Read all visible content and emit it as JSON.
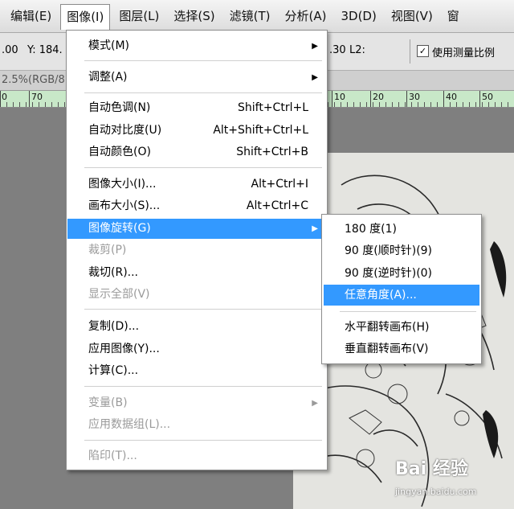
{
  "menubar": {
    "items": [
      "编辑(E)",
      "图像(I)",
      "图层(L)",
      "选择(S)",
      "滤镜(T)",
      "分析(A)",
      "3D(D)",
      "视图(V)",
      "窗"
    ]
  },
  "options_bar": {
    "x_value": ".00",
    "y_label": "Y: 184.",
    "right_value": ".30",
    "l2_label": "L2:",
    "checkbox_checked": true,
    "checkbox_label": "使用测量比例"
  },
  "document_tab": {
    "title": "2.5%(RGB/8"
  },
  "ruler": {
    "labels": [
      "0",
      "70",
      "10",
      "20",
      "30",
      "40",
      "50"
    ]
  },
  "image_menu": {
    "items": [
      {
        "label": "模式(M)",
        "shortcut": "",
        "submenu": true,
        "disabled": false
      },
      {
        "label": "调整(A)",
        "shortcut": "",
        "submenu": true,
        "disabled": false
      },
      {
        "label": "自动色调(N)",
        "shortcut": "Shift+Ctrl+L",
        "submenu": false,
        "disabled": false
      },
      {
        "label": "自动对比度(U)",
        "shortcut": "Alt+Shift+Ctrl+L",
        "submenu": false,
        "disabled": false
      },
      {
        "label": "自动颜色(O)",
        "shortcut": "Shift+Ctrl+B",
        "submenu": false,
        "disabled": false
      },
      {
        "label": "图像大小(I)...",
        "shortcut": "Alt+Ctrl+I",
        "submenu": false,
        "disabled": false
      },
      {
        "label": "画布大小(S)...",
        "shortcut": "Alt+Ctrl+C",
        "submenu": false,
        "disabled": false
      },
      {
        "label": "图像旋转(G)",
        "shortcut": "",
        "submenu": true,
        "disabled": false,
        "highlighted": true
      },
      {
        "label": "裁剪(P)",
        "shortcut": "",
        "submenu": false,
        "disabled": true
      },
      {
        "label": "裁切(R)...",
        "shortcut": "",
        "submenu": false,
        "disabled": false
      },
      {
        "label": "显示全部(V)",
        "shortcut": "",
        "submenu": false,
        "disabled": true
      },
      {
        "label": "复制(D)...",
        "shortcut": "",
        "submenu": false,
        "disabled": false
      },
      {
        "label": "应用图像(Y)...",
        "shortcut": "",
        "submenu": false,
        "disabled": false
      },
      {
        "label": "计算(C)...",
        "shortcut": "",
        "submenu": false,
        "disabled": false
      },
      {
        "label": "变量(B)",
        "shortcut": "",
        "submenu": true,
        "disabled": true
      },
      {
        "label": "应用数据组(L)...",
        "shortcut": "",
        "submenu": false,
        "disabled": true
      },
      {
        "label": "陷印(T)...",
        "shortcut": "",
        "submenu": false,
        "disabled": true
      }
    ]
  },
  "rotate_submenu": {
    "items": [
      {
        "label": "180 度(1)"
      },
      {
        "label": "90 度(顺时针)(9)"
      },
      {
        "label": "90 度(逆时针)(0)"
      },
      {
        "label": "任意角度(A)...",
        "highlighted": true
      },
      {
        "label": "水平翻转画布(H)"
      },
      {
        "label": "垂直翻转画布(V)"
      }
    ]
  },
  "watermark": {
    "logo": "Bai 经验",
    "url": "jingyan.baidu.com"
  },
  "colors": {
    "highlight": "#3399ff",
    "ruler": "#c8e8c8"
  }
}
